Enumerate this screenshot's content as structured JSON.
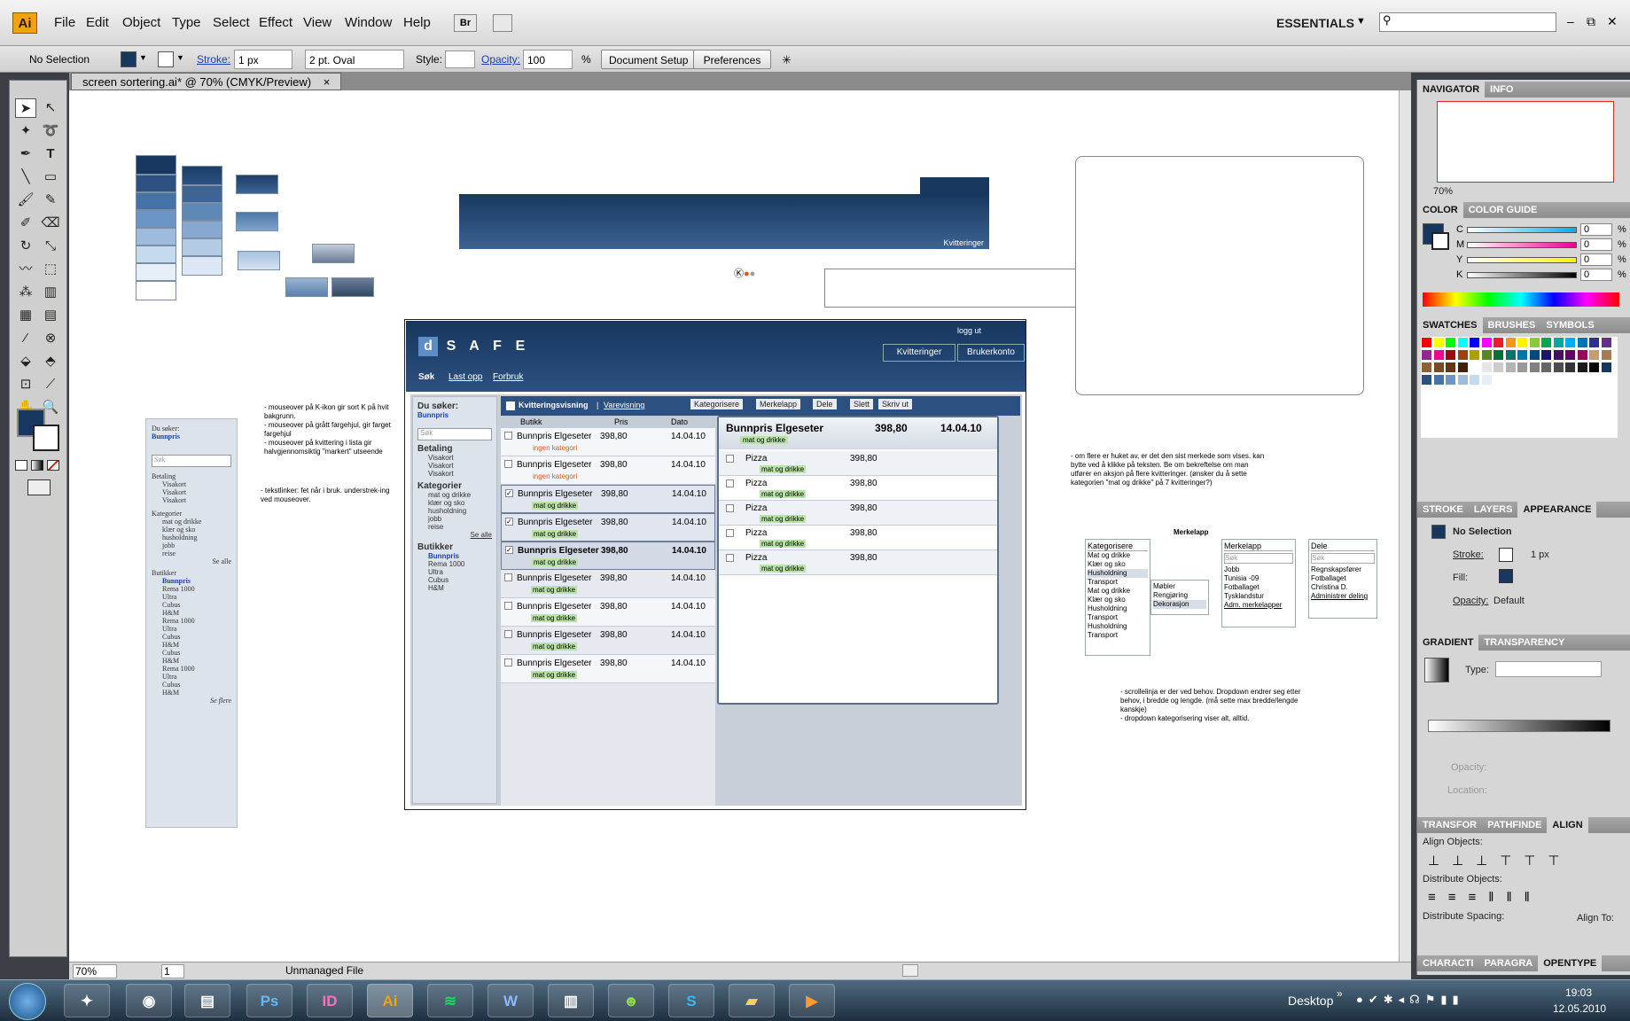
{
  "app": {
    "logo": "Ai",
    "menus": [
      "File",
      "Edit",
      "Object",
      "Type",
      "Select",
      "Effect",
      "View",
      "Window",
      "Help"
    ],
    "bridge_btn": "Br",
    "workspace": "ESSENTIALS",
    "window_controls": [
      "–",
      "⧉",
      "✕"
    ]
  },
  "control_bar": {
    "selection": "No Selection",
    "stroke_label": "Stroke:",
    "stroke_value": "1 px",
    "brush": "2 pt. Oval",
    "style_label": "Style:",
    "opacity_label": "Opacity:",
    "opacity_value": "100",
    "percent": "%",
    "doc_setup": "Document Setup",
    "preferences": "Preferences"
  },
  "document": {
    "tab_title": "screen sortering.ai* @ 70% (CMYK/Preview)",
    "tab_close": "×",
    "zoom": "70%",
    "page": "1",
    "status": "Unmanaged File"
  },
  "canvas": {
    "banner_label": "Kvitteringer",
    "notes": {
      "left1": "- mouseover på K-ikon gir sort K på hvit bakgrunn.\n- mouseover på grått fargehjul, gir farget fargehjul\n- mouseover på kvittering i lista gir halvgjennomsiktig \"markert\" utseende",
      "left2": "- tekstlinker: fet når i bruk. understrek-ing ved mouseover.",
      "right1": "- om flere er huket av, er det den sist merkede som vises. kan bytte ved å klikke på teksten. Be om bekreftelse om man utfører en aksjon på flere kvitteringer. (ønsker du å sette kategorien \"mat og drikke\" på 7 kvitteringer?)",
      "right2": "- scrollelinja er der ved behov. Dropdown endrer seg etter behov, i bredde og lengde. (må sette max bredde/lengde kanskje)\n- dropdown kategorisering viser alt, alltid."
    },
    "mini_sidebar": {
      "du_soker": "Du søker:",
      "filter": "Bunnpris",
      "sok": "Søk",
      "betaling": "Betaling",
      "betaling_items": [
        "Visakort",
        "Visakort",
        "Visakort"
      ],
      "kategorier": "Kategorier",
      "kategori_items": [
        "mat og drikke",
        "klær og sko",
        "husholdning",
        "jobb",
        "reise"
      ],
      "se_alle": "Se alle",
      "butikker": "Butikker",
      "butikk_items": [
        "Bunnpris",
        "Rema 1000",
        "Ultra",
        "Cubus",
        "H&M",
        "Rema 1000",
        "Ultra",
        "Cubus",
        "H&M",
        "Cubus",
        "H&M",
        "Rema 1000",
        "Ultra",
        "Cubus",
        "H&M"
      ],
      "se_flere": "Se flere"
    },
    "dsafe": {
      "letters": [
        "d",
        "S",
        "A",
        "F",
        "E"
      ],
      "logout": "logg ut",
      "tabs": [
        "Kvitteringer",
        "Brukerkonto"
      ],
      "subnav": [
        "Søk",
        "Last opp",
        "Forbruk"
      ],
      "side": {
        "du_soker": "Du søker:",
        "filter": "Bunnpris",
        "sok": "Søk",
        "betaling": "Betaling",
        "betaling_items": [
          "Visakort",
          "Visakort",
          "Visakort"
        ],
        "kategorier": "Kategorier",
        "kategori_items": [
          "mat og drikke",
          "klær og sko",
          "husholdning",
          "jobb",
          "reise"
        ],
        "se_alle": "Se alle",
        "butikker": "Butikker",
        "butikk_items": [
          "Bunnpris",
          "Rema 1000",
          "Ultra",
          "Cubus",
          "H&M"
        ]
      },
      "toolbar": {
        "view1": "Kvitteringsvisning",
        "sep": "|",
        "view2": "Varevisning",
        "kategorisere": "Kategorisere",
        "merkelapp": "Merkelapp",
        "dele": "Dele",
        "slett": "Slett",
        "skriv_ut": "Skriv ut"
      },
      "columns": [
        "Butikk",
        "Pris",
        "Dato"
      ],
      "rows": [
        {
          "name": "Bunnpris Elgeseter",
          "price": "398,80",
          "date": "14.04.10",
          "tag": "ingen kategori",
          "checked": "",
          "style": "none"
        },
        {
          "name": "Bunnpris Elgeseter",
          "price": "398,80",
          "date": "14.04.10",
          "tag": "ingen kategori",
          "checked": "",
          "style": "none"
        },
        {
          "name": "Bunnpris Elgeseter",
          "price": "398,80",
          "date": "14.04.10",
          "tag": "mat og drikke",
          "checked": "✓",
          "style": "sel"
        },
        {
          "name": "Bunnpris Elgeseter",
          "price": "398,80",
          "date": "14.04.10",
          "tag": "mat og drikke",
          "checked": "✓",
          "style": "sel"
        },
        {
          "name": "Bunnpris Elgeseter",
          "price": "398,80",
          "date": "14.04.10",
          "tag": "mat og drikke",
          "checked": "✓",
          "style": "selbold"
        },
        {
          "name": "Bunnpris Elgeseter",
          "price": "398,80",
          "date": "14.04.10",
          "tag": "mat og drikke",
          "checked": "",
          "style": "alt"
        },
        {
          "name": "Bunnpris Elgeseter",
          "price": "398,80",
          "date": "14.04.10",
          "tag": "mat og drikke",
          "checked": "",
          "style": "none"
        },
        {
          "name": "Bunnpris Elgeseter",
          "price": "398,80",
          "date": "14.04.10",
          "tag": "mat og drikke",
          "checked": "",
          "style": "alt"
        },
        {
          "name": "Bunnpris Elgeseter",
          "price": "398,80",
          "date": "14.04.10",
          "tag": "mat og drikke",
          "checked": "",
          "style": "none"
        }
      ],
      "detail": {
        "name": "Bunnpris Elgeseter",
        "price": "398,80",
        "date": "14.04.10",
        "tag": "mat og drikke",
        "items": [
          {
            "name": "Pizza",
            "price": "398,80",
            "tag": "mat og drikke"
          },
          {
            "name": "Pizza",
            "price": "398,80",
            "tag": "mat og drikke"
          },
          {
            "name": "Pizza",
            "price": "398,80",
            "tag": "mat og drikke"
          },
          {
            "name": "Pizza",
            "price": "398,80",
            "tag": "mat og drikke"
          },
          {
            "name": "Pizza",
            "price": "398,80",
            "tag": "mat og drikke"
          }
        ]
      }
    },
    "dropdowns": {
      "merkelapp_title": "Merkelapp",
      "kat_label": "Kategorisere",
      "kat_items": [
        "Mat og drikke",
        "Klær og sko",
        "Husholdning",
        "Transport",
        "Mat og drikke",
        "Klær og sko",
        "Husholdning",
        "Transport",
        "Husholdning",
        "Transport"
      ],
      "kat_sub": [
        "Møbler",
        "Rengjøring",
        "Dekorasjon"
      ],
      "merke_label": "Merkelapp",
      "merke_sok": "Søk",
      "merke_items": [
        "Jobb",
        "Tunisia -09",
        "Fotballaget",
        "Tysklandstur"
      ],
      "merke_admin": "Adm. merkelapper",
      "dele_label": "Dele",
      "dele_sok": "Søk",
      "dele_items": [
        "Regnskapsfører",
        "Fotballaget",
        "Christina D."
      ],
      "dele_admin": "Administrer deling"
    }
  },
  "panels": {
    "navigator": {
      "tabs": [
        "NAVIGATOR",
        "INFO"
      ],
      "zoom": "70%"
    },
    "color": {
      "tabs": [
        "COLOR",
        "COLOR GUIDE"
      ],
      "channels": [
        {
          "label": "C",
          "value": "0",
          "color": "#00aeef"
        },
        {
          "label": "M",
          "value": "0",
          "color": "#ec008c"
        },
        {
          "label": "Y",
          "value": "0",
          "color": "#fff200"
        },
        {
          "label": "K",
          "value": "0",
          "color": "#000000"
        }
      ],
      "percent": "%"
    },
    "swatches": {
      "tabs": [
        "SWATCHES",
        "BRUSHES",
        "SYMBOLS"
      ]
    },
    "appearance": {
      "tabs": [
        "STROKE",
        "LAYERS",
        "APPEARANCE"
      ],
      "title": "No Selection",
      "stroke_label": "Stroke:",
      "stroke_value": "1 px",
      "fill_label": "Fill:",
      "opacity_label": "Opacity:",
      "opacity_value": "Default"
    },
    "gradient": {
      "tabs": [
        "GRADIENT",
        "TRANSPARENCY"
      ],
      "type_label": "Type:",
      "opacity_label": "Opacity:",
      "location_label": "Location:",
      "percent": "%"
    },
    "align": {
      "tabs": [
        "TRANSFOR",
        "PATHFINDE",
        "ALIGN"
      ],
      "align_objects": "Align Objects:",
      "distribute_objects": "Distribute Objects:",
      "distribute_spacing": "Distribute Spacing:",
      "align_to": "Align To:"
    },
    "type": {
      "tabs": [
        "CHARACTI",
        "PARAGRA",
        "OPENTYPE"
      ]
    }
  },
  "taskbar": {
    "apps": [
      "Ps",
      "ID",
      "Ai",
      "W",
      "S"
    ],
    "desktop": "Desktop",
    "time": "19:03",
    "date": "12.05.2010"
  },
  "colors": {
    "brand_dark": "#17375e",
    "brand_mid": "#2c5080",
    "tag_green": "#b9e3a8",
    "tag_red": "#e2541e"
  }
}
